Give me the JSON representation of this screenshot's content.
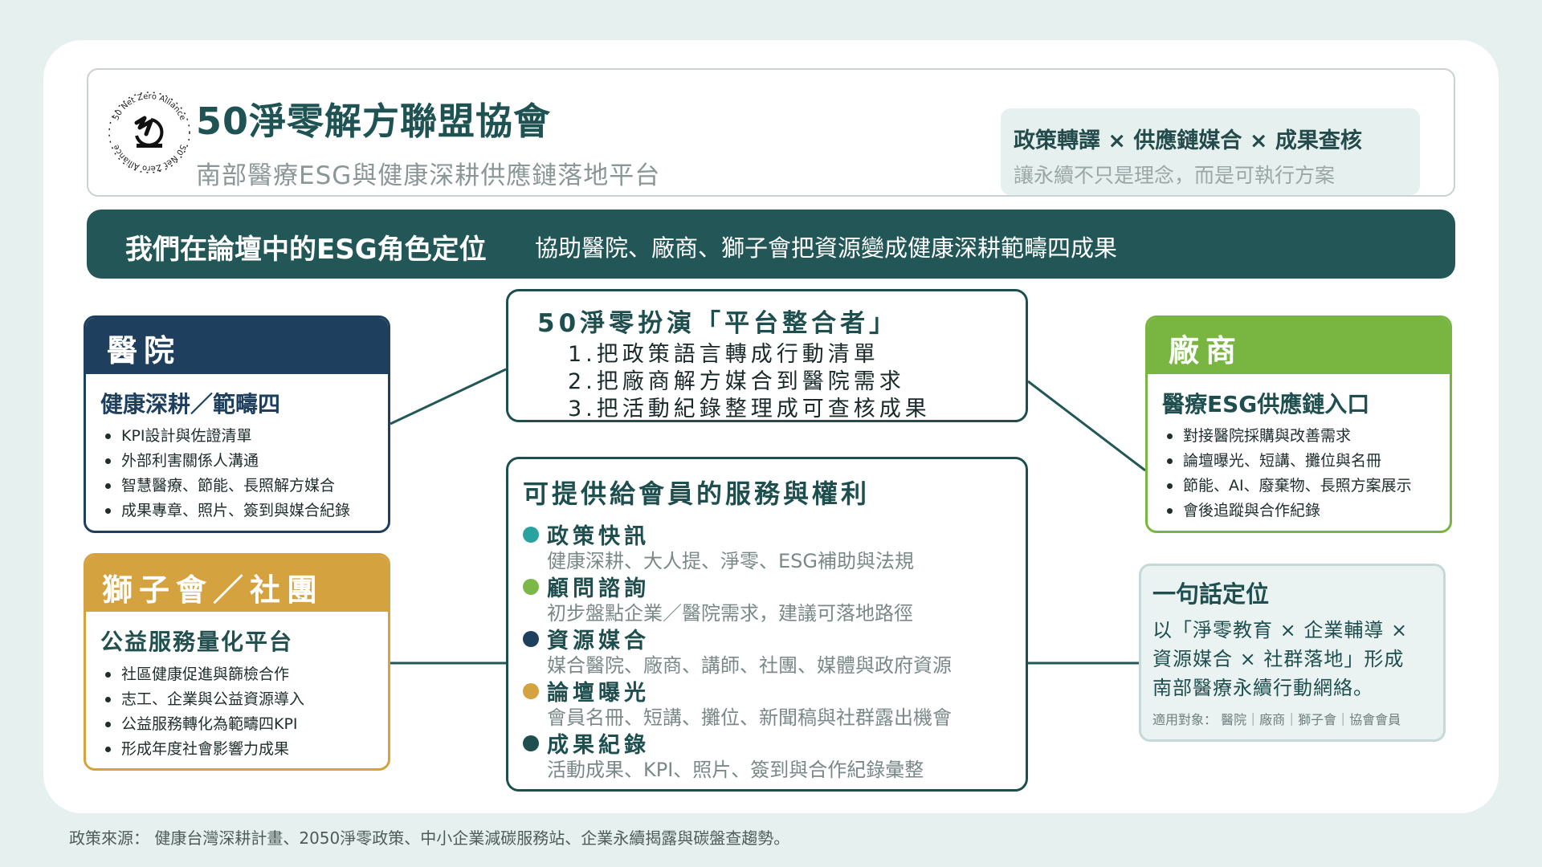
{
  "header": {
    "logo_text": "50 Net Zero Alliance",
    "title": "50淨零解方聯盟協會",
    "subtitle": "南部醫療ESG與健康深耕供應鏈落地平台",
    "slogan": "政策轉譯 × 供應鏈媒合 × 成果查核",
    "slogan_sub": "讓永續不只是理念，而是可執行方案"
  },
  "banner": {
    "title": "我們在論壇中的ESG角色定位",
    "text": "協助醫院、廠商、獅子會把資源變成健康深耕範疇四成果"
  },
  "hospital": {
    "title": "醫院",
    "subtitle": "健康深耕／範疇四",
    "items": [
      "KPI設計與佐證清單",
      "外部利害關係人溝通",
      "智慧醫療、節能、長照解方媒合",
      "成果專章、照片、簽到與媒合紀錄"
    ]
  },
  "lions": {
    "title": "獅子會／社團",
    "subtitle": "公益服務量化平台",
    "items": [
      "社區健康促進與篩檢合作",
      "志工、企業與公益資源導入",
      "公益服務轉化為範疇四KPI",
      "形成年度社會影響力成果"
    ]
  },
  "vendor": {
    "title": "廠商",
    "subtitle": "醫療ESG供應鏈入口",
    "items": [
      "對接醫院採購與改善需求",
      "論壇曝光、短講、攤位與名冊",
      "節能、AI、廢棄物、長照方案展示",
      "會後追蹤與合作紀錄"
    ]
  },
  "role": {
    "title": "50淨零扮演「平台整合者」",
    "items": [
      "1.把政策語言轉成行動清單",
      "2.把廠商解方媒合到醫院需求",
      "3.把活動紀錄整理成可查核成果"
    ]
  },
  "services": {
    "title": "可提供給會員的服務與權利",
    "items": [
      {
        "name": "政策快訊",
        "desc": "健康深耕、大人提、淨零、ESG補助與法規",
        "color": "#2aa3a0"
      },
      {
        "name": "顧問諮詢",
        "desc": "初步盤點企業／醫院需求，建議可落地路徑",
        "color": "#7cb846"
      },
      {
        "name": "資源媒合",
        "desc": "媒合醫院、廠商、講師、社團、媒體與政府資源",
        "color": "#1e3f5e"
      },
      {
        "name": "論壇曝光",
        "desc": "會員名冊、短講、攤位、新聞稿與社群露出機會",
        "color": "#d4a23e"
      },
      {
        "name": "成果紀錄",
        "desc": "活動成果、KPI、照片、簽到與合作紀錄彙整",
        "color": "#1e4e4e"
      }
    ]
  },
  "oneline": {
    "title": "一句話定位",
    "lines": [
      "以「淨零教育 × 企業輔導 ×",
      "資源媒合 × 社群落地」形成",
      "南部醫療永續行動網絡。"
    ],
    "audience": "適用對象： 醫院｜廠商｜獅子會｜協會會員"
  },
  "source": "政策來源： 健康台灣深耕計畫、2050淨零政策、中小企業減碳服務站、企業永續揭露與碳盤查趨勢。",
  "colors": {
    "primary": "#235757",
    "hospital": "#1e3f5e",
    "lions": "#d4a23e",
    "vendor": "#78b641",
    "background": "#e6f1ef"
  }
}
